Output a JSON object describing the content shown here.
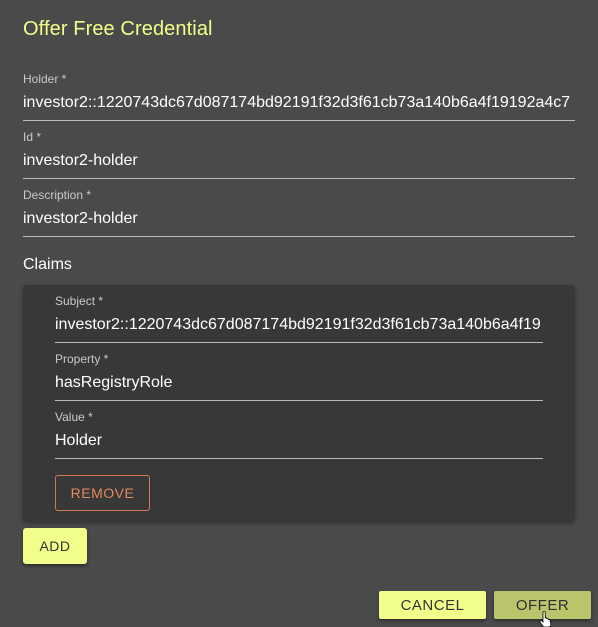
{
  "dialog": {
    "title": "Offer Free Credential"
  },
  "fields": {
    "holder": {
      "label": "Holder *",
      "value": "investor2::1220743dc67d087174bd92191f32d3f61cb73a140b6a4f19192a4c7"
    },
    "id": {
      "label": "Id *",
      "value": "investor2-holder"
    },
    "description": {
      "label": "Description *",
      "value": "investor2-holder"
    }
  },
  "claims": {
    "title": "Claims",
    "items": [
      {
        "subject": {
          "label": "Subject *",
          "value": "investor2::1220743dc67d087174bd92191f32d3f61cb73a140b6a4f19"
        },
        "property": {
          "label": "Property *",
          "value": "hasRegistryRole"
        },
        "value": {
          "label": "Value *",
          "value": "Holder"
        },
        "remove_label": "REMOVE"
      }
    ],
    "add_label": "ADD"
  },
  "actions": {
    "cancel_label": "CANCEL",
    "offer_label": "OFFER"
  },
  "colors": {
    "background": "#4a4a4a",
    "accent": "#f1ff8a",
    "accent_pressed": "#b9c46b",
    "remove": "#e08a60"
  },
  "icons": {
    "cursor": "hand-pointer-icon"
  }
}
